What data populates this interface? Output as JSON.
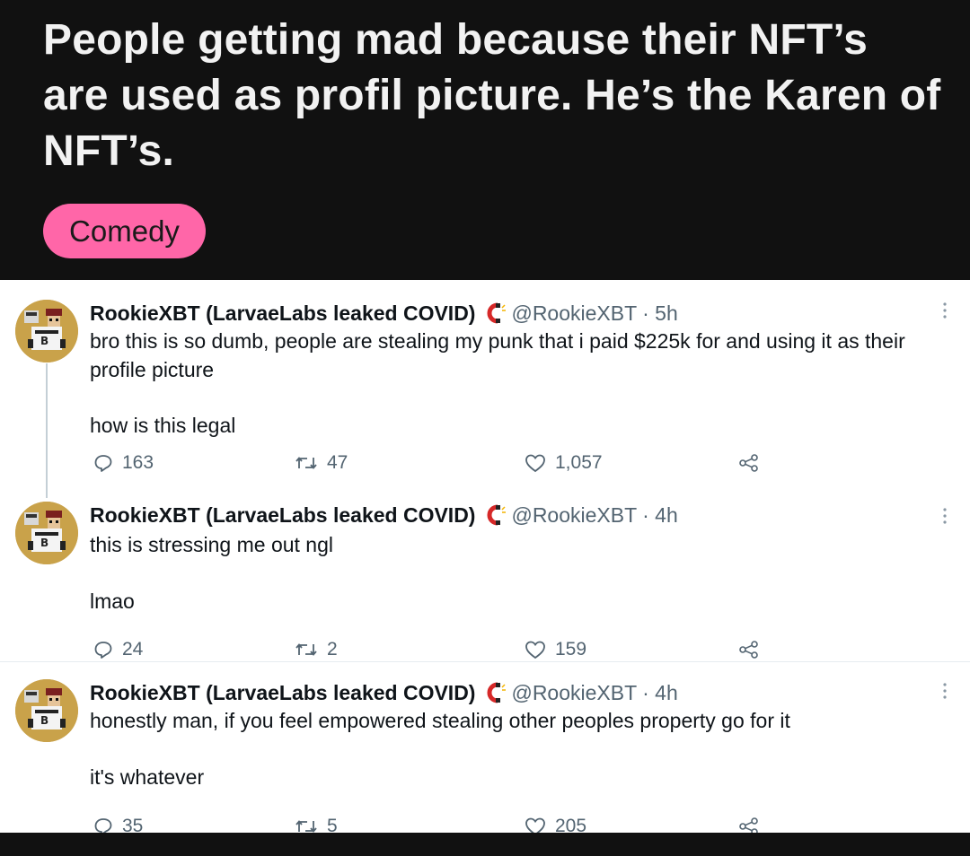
{
  "post": {
    "title": "People getting mad because their NFT’s are used as profil picture. He’s the Karen of NFT’s.",
    "flair": "Comedy",
    "flair_color": "#ff66a8"
  },
  "tweets": [
    {
      "author": "RookieXBT (LarvaeLabs leaked COVID)",
      "handle": "@RookieXBT",
      "time": "· 5h",
      "text_lines": [
        "bro this is so dumb, people are stealing my punk that i paid $225k for and using it as their profile picture",
        "how is this legal"
      ],
      "replies": "163",
      "retweets": "47",
      "likes": "1,057"
    },
    {
      "author": "RookieXBT (LarvaeLabs leaked COVID)",
      "handle": "@RookieXBT",
      "time": "· 4h",
      "text_lines": [
        "this is stressing me out ngl",
        "lmao"
      ],
      "replies": "24",
      "retweets": "2",
      "likes": "159"
    },
    {
      "author": "RookieXBT (LarvaeLabs leaked COVID)",
      "handle": "@RookieXBT",
      "time": "· 4h",
      "text_lines": [
        "honestly man, if you feel empowered stealing other peoples property go for it",
        "it's whatever"
      ],
      "replies": "35",
      "retweets": "5",
      "likes": "205"
    }
  ],
  "icons": {
    "name_badge": "magnet-icon",
    "reply": "reply-icon",
    "retweet": "retweet-icon",
    "like": "heart-icon",
    "share": "share-icon",
    "more": "more-icon"
  }
}
